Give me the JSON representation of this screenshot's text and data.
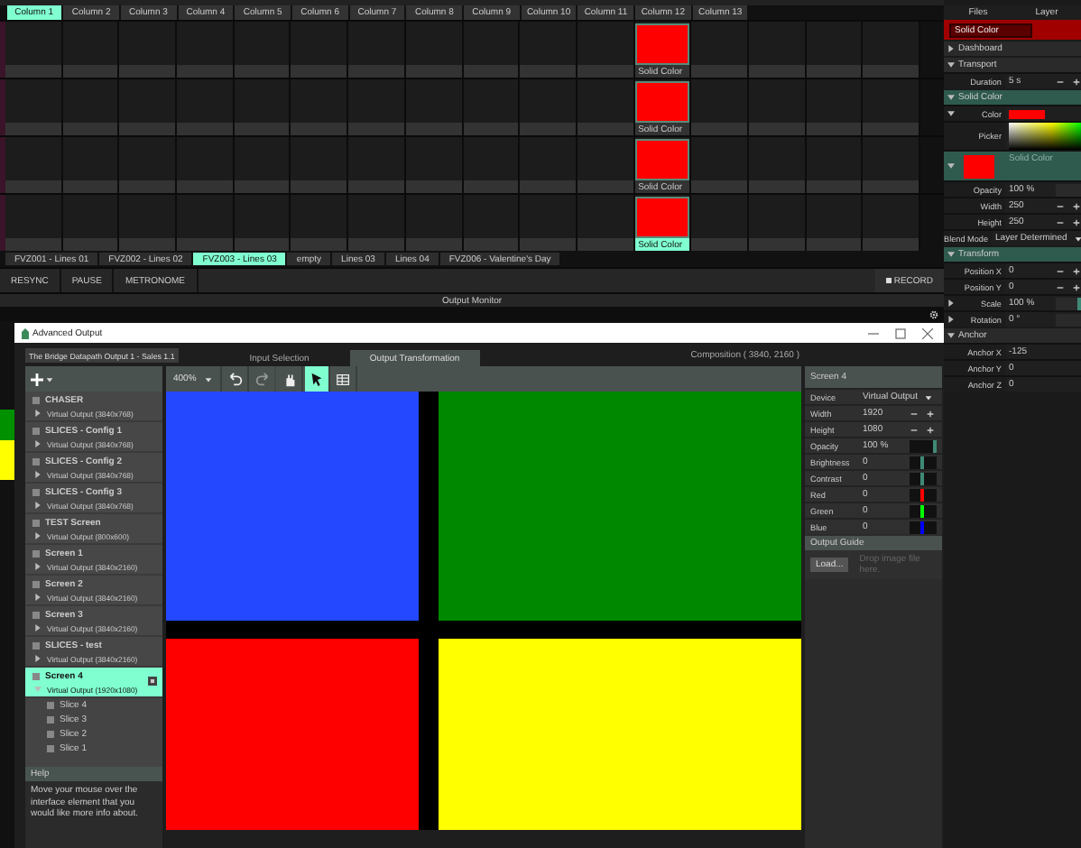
{
  "main": {
    "columns": [
      {
        "label": "Column 1",
        "selected": true
      },
      {
        "label": "Column 2",
        "selected": false
      },
      {
        "label": "Column 3",
        "selected": false
      },
      {
        "label": "Column 4",
        "selected": false
      },
      {
        "label": "Column 5",
        "selected": false
      },
      {
        "label": "Column 6",
        "selected": false
      },
      {
        "label": "Column 7",
        "selected": false
      },
      {
        "label": "Column 8",
        "selected": false
      },
      {
        "label": "Column 9",
        "selected": false
      },
      {
        "label": "Column 10",
        "selected": false
      },
      {
        "label": "Column 11",
        "selected": false
      },
      {
        "label": "Column 12",
        "selected": false
      },
      {
        "label": "Column 13",
        "selected": false
      }
    ],
    "layers": [
      {
        "cells": [
          {
            "kind": "empty"
          },
          {
            "kind": "empty"
          },
          {
            "kind": "empty"
          },
          {
            "kind": "empty"
          },
          {
            "kind": "empty"
          },
          {
            "kind": "empty"
          },
          {
            "kind": "empty"
          },
          {
            "kind": "empty"
          },
          {
            "kind": "empty"
          },
          {
            "kind": "empty"
          },
          {
            "kind": "empty"
          },
          {
            "kind": "clip",
            "name": "Solid Color",
            "color": "#ff0000",
            "selected": false
          },
          {
            "kind": "empty"
          },
          {
            "kind": "empty"
          },
          {
            "kind": "empty"
          },
          {
            "kind": "empty"
          }
        ]
      },
      {
        "cells": [
          {
            "kind": "empty"
          },
          {
            "kind": "empty"
          },
          {
            "kind": "empty"
          },
          {
            "kind": "empty"
          },
          {
            "kind": "empty"
          },
          {
            "kind": "empty"
          },
          {
            "kind": "empty"
          },
          {
            "kind": "empty"
          },
          {
            "kind": "empty"
          },
          {
            "kind": "empty"
          },
          {
            "kind": "empty"
          },
          {
            "kind": "clip",
            "name": "Solid Color",
            "color": "#ff0000",
            "selected": false
          },
          {
            "kind": "empty"
          },
          {
            "kind": "empty"
          },
          {
            "kind": "empty"
          },
          {
            "kind": "empty"
          }
        ]
      },
      {
        "cells": [
          {
            "kind": "empty"
          },
          {
            "kind": "empty"
          },
          {
            "kind": "empty"
          },
          {
            "kind": "empty"
          },
          {
            "kind": "empty"
          },
          {
            "kind": "empty"
          },
          {
            "kind": "empty"
          },
          {
            "kind": "empty"
          },
          {
            "kind": "empty"
          },
          {
            "kind": "empty"
          },
          {
            "kind": "empty"
          },
          {
            "kind": "clip",
            "name": "Solid Color",
            "color": "#ff0000",
            "selected": false
          },
          {
            "kind": "empty"
          },
          {
            "kind": "empty"
          },
          {
            "kind": "empty"
          },
          {
            "kind": "empty"
          }
        ]
      },
      {
        "cells": [
          {
            "kind": "empty"
          },
          {
            "kind": "empty"
          },
          {
            "kind": "empty"
          },
          {
            "kind": "empty"
          },
          {
            "kind": "empty"
          },
          {
            "kind": "empty"
          },
          {
            "kind": "empty"
          },
          {
            "kind": "empty"
          },
          {
            "kind": "empty"
          },
          {
            "kind": "empty"
          },
          {
            "kind": "empty"
          },
          {
            "kind": "clip",
            "name": "Solid Color",
            "color": "#ff0000",
            "selected": true
          },
          {
            "kind": "empty"
          },
          {
            "kind": "empty"
          },
          {
            "kind": "empty"
          },
          {
            "kind": "empty"
          }
        ]
      }
    ],
    "decks": [
      {
        "label": "FVZ001 - Lines 01",
        "selected": false
      },
      {
        "label": "FVZ002 - Lines 02",
        "selected": false
      },
      {
        "label": "FVZ003 - Lines 03",
        "selected": true
      },
      {
        "label": "empty",
        "selected": false
      },
      {
        "label": "Lines 03",
        "selected": false
      },
      {
        "label": "Lines 04",
        "selected": false
      },
      {
        "label": "FVZ006 - Valentine's Day",
        "selected": false
      }
    ],
    "transport_buttons": [
      "RESYNC",
      "PAUSE",
      "METRONOME"
    ],
    "record_button": "RECORD",
    "output_monitor": "Output Monitor"
  },
  "inspector": {
    "tabs": [
      {
        "label": "Files",
        "selected": false
      },
      {
        "label": "Layer",
        "selected": false
      }
    ],
    "clip_name": "Solid Color",
    "rows": [
      {
        "kind": "section",
        "label": "Dashboard",
        "expanded": false,
        "active": false
      },
      {
        "kind": "section",
        "label": "Transport",
        "expanded": true,
        "active": false
      },
      {
        "kind": "stepper",
        "label": "Duration",
        "value": "5 s"
      },
      {
        "kind": "section",
        "label": "Solid Color",
        "expanded": true,
        "active": true
      },
      {
        "kind": "color",
        "label": "Color",
        "color": "#ff0000",
        "expanded": true
      },
      {
        "kind": "picker",
        "label": "Picker"
      },
      {
        "kind": "thumbnail",
        "name": "Solid Color",
        "color": "#ff0000",
        "expanded": true
      },
      {
        "kind": "meter",
        "label": "Opacity",
        "value": "100 %"
      },
      {
        "kind": "stepper",
        "label": "Width",
        "value": "250"
      },
      {
        "kind": "stepper",
        "label": "Height",
        "value": "250"
      },
      {
        "kind": "dropdown",
        "label": "Blend Mode",
        "value": "Layer Determined"
      },
      {
        "kind": "section",
        "label": "Transform",
        "expanded": true,
        "active": true
      },
      {
        "kind": "stepper",
        "label": "Position X",
        "value": "0"
      },
      {
        "kind": "stepper",
        "label": "Position Y",
        "value": "0"
      },
      {
        "kind": "slider",
        "label": "Scale",
        "value": "100 %",
        "level": 1,
        "expanded": false
      },
      {
        "kind": "meter",
        "label": "Rotation",
        "value": "0 °",
        "expanded": false
      },
      {
        "kind": "section",
        "label": "Anchor",
        "expanded": true,
        "active": false
      },
      {
        "kind": "value",
        "label": "Anchor X",
        "value": "-125"
      },
      {
        "kind": "value",
        "label": "Anchor Y",
        "value": "0"
      },
      {
        "kind": "value",
        "label": "Anchor Z",
        "value": "0"
      }
    ]
  },
  "advanced_output": {
    "title": "Advanced Output",
    "preset": "The Bridge Datapath Output 1 - Sales 1.1",
    "tabs": [
      {
        "label": "Input Selection",
        "selected": false
      },
      {
        "label": "Output Transformation",
        "selected": true
      }
    ],
    "composition": "Composition ( 3840, 2160 )",
    "zoom": "400%",
    "tools": [
      {
        "kind": "undo",
        "selected": false,
        "disabled": false
      },
      {
        "kind": "redo",
        "selected": false,
        "disabled": true
      },
      {
        "kind": "hand",
        "selected": false,
        "disabled": false
      },
      {
        "kind": "pointer",
        "selected": true,
        "disabled": false
      },
      {
        "kind": "grid",
        "selected": false,
        "disabled": false
      }
    ],
    "screens": [
      {
        "name": "CHASER",
        "device": "Virtual Output (3840x768)",
        "selected": false,
        "expanded": false,
        "checked": false
      },
      {
        "name": "SLICES - Config 1",
        "device": "Virtual Output (3840x768)",
        "selected": false,
        "expanded": false,
        "checked": false
      },
      {
        "name": "SLICES - Config 2",
        "device": "Virtual Output (3840x768)",
        "selected": false,
        "expanded": false,
        "checked": false
      },
      {
        "name": "SLICES - Config 3",
        "device": "Virtual Output (3840x768)",
        "selected": false,
        "expanded": false,
        "checked": false
      },
      {
        "name": "TEST Screen",
        "device": "Virtual Output (800x600)",
        "selected": false,
        "expanded": false,
        "checked": false
      },
      {
        "name": "Screen 1",
        "device": "Virtual Output (3840x2160)",
        "selected": false,
        "expanded": false,
        "checked": false
      },
      {
        "name": "Screen 2",
        "device": "Virtual Output (3840x2160)",
        "selected": false,
        "expanded": false,
        "checked": false
      },
      {
        "name": "Screen 3",
        "device": "Virtual Output (3840x2160)",
        "selected": false,
        "expanded": false,
        "checked": false
      },
      {
        "name": "SLICES - test",
        "device": "Virtual Output (3840x2160)",
        "selected": false,
        "expanded": false,
        "checked": false
      },
      {
        "name": "Screen 4",
        "device": "Virtual Output (1920x1080)",
        "selected": true,
        "expanded": true,
        "checked": false,
        "children": [
          {
            "name": "Slice 4",
            "checked": false
          },
          {
            "name": "Slice 3",
            "checked": false
          },
          {
            "name": "Slice 2",
            "checked": false
          },
          {
            "name": "Slice 1",
            "checked": false
          }
        ]
      }
    ],
    "help": {
      "title": "Help",
      "text": "Move your mouse over the interface element that you would like more info about."
    },
    "slices": [
      {
        "color": "#2448ff"
      },
      {
        "color": "#008800"
      },
      {
        "color": "#ff0000"
      },
      {
        "color": "#ffff00"
      }
    ],
    "properties": {
      "title": "Screen 4",
      "rows": [
        {
          "kind": "dropdown",
          "label": "Device",
          "value": "Virtual Output"
        },
        {
          "kind": "stepper",
          "label": "Width",
          "value": "1920"
        },
        {
          "kind": "stepper",
          "label": "Height",
          "value": "1080"
        },
        {
          "kind": "slider",
          "label": "Opacity",
          "value": "100 %",
          "level": 1,
          "color": "#3f8a76"
        },
        {
          "kind": "slider",
          "label": "Brightness",
          "value": "0",
          "level": 0.5,
          "color": "#3f8a76"
        },
        {
          "kind": "slider",
          "label": "Contrast",
          "value": "0",
          "level": 0.5,
          "color": "#3f8a76"
        },
        {
          "kind": "slider",
          "label": "Red",
          "value": "0",
          "level": 0.5,
          "color": "#ff0000"
        },
        {
          "kind": "slider",
          "label": "Green",
          "value": "0",
          "level": 0.5,
          "color": "#00ff00"
        },
        {
          "kind": "slider",
          "label": "Blue",
          "value": "0",
          "level": 0.5,
          "color": "#0000ff"
        }
      ]
    },
    "output_guide": {
      "title": "Output Guide",
      "button": "Load...",
      "placeholder": "Drop image file here."
    }
  }
}
